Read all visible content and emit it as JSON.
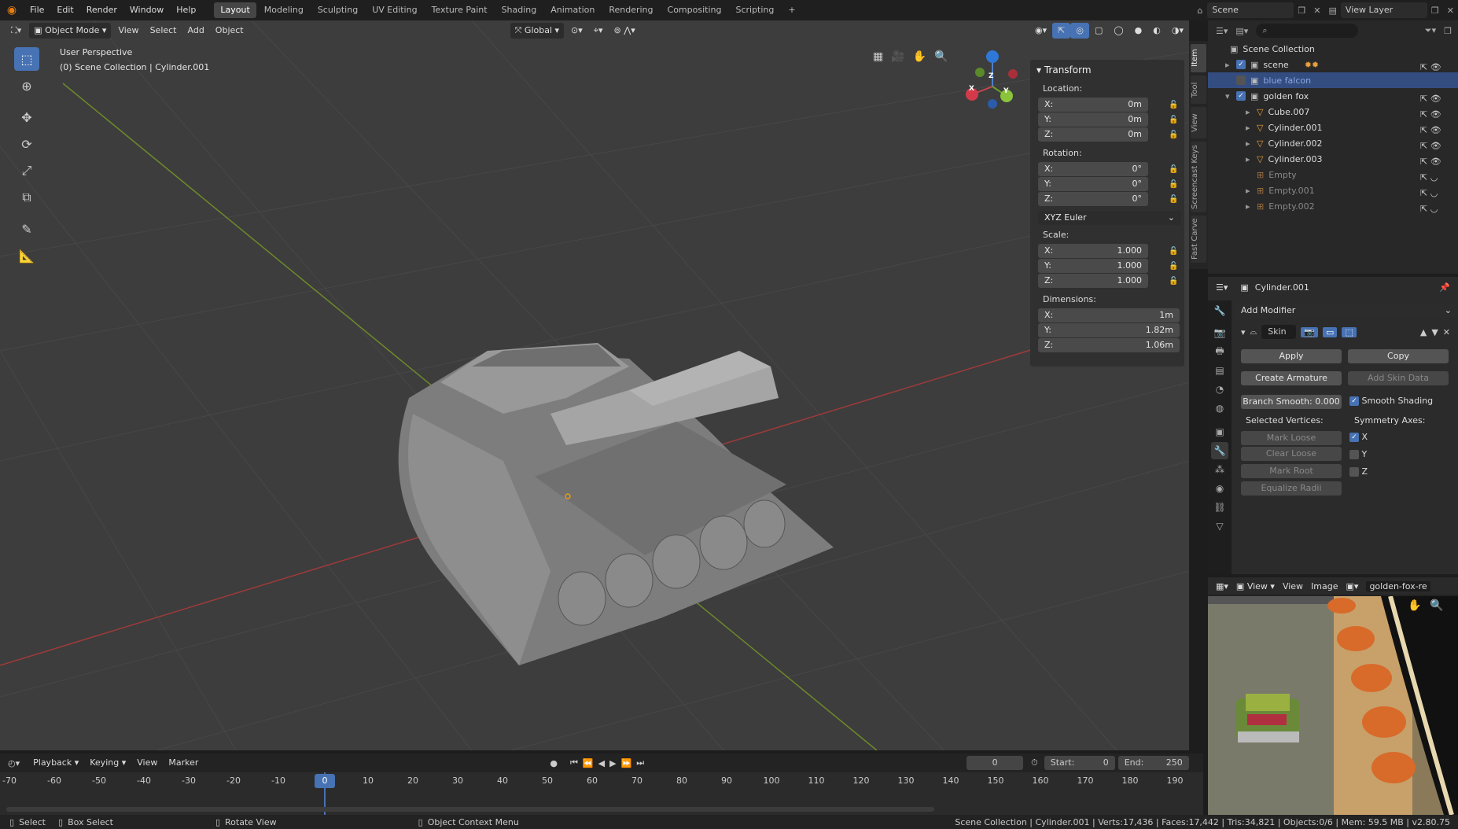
{
  "topbar": {
    "menus": [
      "File",
      "Edit",
      "Render",
      "Window",
      "Help"
    ],
    "workspaces": [
      "Layout",
      "Modeling",
      "Sculpting",
      "UV Editing",
      "Texture Paint",
      "Shading",
      "Animation",
      "Rendering",
      "Compositing",
      "Scripting"
    ],
    "active_workspace": "Layout",
    "add_tab": "+",
    "scene": "Scene",
    "view_layer": "View Layer"
  },
  "viewport": {
    "mode": "Object Mode",
    "menus": [
      "View",
      "Select",
      "Add",
      "Object"
    ],
    "orientation": "Global",
    "perspective_label": "User Perspective",
    "collection_label": "(0) Scene Collection | Cylinder.001",
    "gizmo": {
      "x": "X",
      "y": "Y",
      "z": "Z"
    }
  },
  "transform": {
    "title": "Transform",
    "location_label": "Location:",
    "location": [
      {
        "axis": "X:",
        "value": "0m"
      },
      {
        "axis": "Y:",
        "value": "0m"
      },
      {
        "axis": "Z:",
        "value": "0m"
      }
    ],
    "rotation_label": "Rotation:",
    "rotation": [
      {
        "axis": "X:",
        "value": "0°"
      },
      {
        "axis": "Y:",
        "value": "0°"
      },
      {
        "axis": "Z:",
        "value": "0°"
      }
    ],
    "rotation_mode": "XYZ Euler",
    "scale_label": "Scale:",
    "scale": [
      {
        "axis": "X:",
        "value": "1.000"
      },
      {
        "axis": "Y:",
        "value": "1.000"
      },
      {
        "axis": "Z:",
        "value": "1.000"
      }
    ],
    "dimensions_label": "Dimensions:",
    "dimensions": [
      {
        "axis": "X:",
        "value": "1m"
      },
      {
        "axis": "Y:",
        "value": "1.82m"
      },
      {
        "axis": "Z:",
        "value": "1.06m"
      }
    ]
  },
  "side_tabs": [
    "Item",
    "Tool",
    "View",
    "Screencast Keys",
    "Fast Carve"
  ],
  "outliner": {
    "root": "Scene Collection",
    "rows": [
      {
        "name": "scene",
        "indent": 1
      },
      {
        "name": "blue falcon",
        "indent": 1
      },
      {
        "name": "golden fox",
        "indent": 1
      },
      {
        "name": "Cube.007",
        "indent": 2
      },
      {
        "name": "Cylinder.001",
        "indent": 2
      },
      {
        "name": "Cylinder.002",
        "indent": 2
      },
      {
        "name": "Cylinder.003",
        "indent": 2
      },
      {
        "name": "Empty",
        "indent": 2
      },
      {
        "name": "Empty.001",
        "indent": 2
      },
      {
        "name": "Empty.002",
        "indent": 2
      }
    ]
  },
  "properties": {
    "object_name": "Cylinder.001",
    "add_modifier": "Add Modifier",
    "modifier_name": "Skin",
    "apply": "Apply",
    "copy": "Copy",
    "create_armature": "Create Armature",
    "add_skin_data": "Add Skin Data",
    "branch_smooth": "Branch Smooth: 0.000",
    "smooth_shading": "Smooth Shading",
    "selected_vertices": "Selected Vertices:",
    "symmetry_axes": "Symmetry Axes:",
    "mark_loose": "Mark Loose",
    "clear_loose": "Clear Loose",
    "mark_root": "Mark Root",
    "equalize_radii": "Equalize Radii",
    "axes": [
      {
        "label": "X",
        "checked": true
      },
      {
        "label": "Y",
        "checked": false
      },
      {
        "label": "Z",
        "checked": false
      }
    ]
  },
  "image_editor": {
    "menus": [
      "View",
      "View",
      "Image"
    ],
    "image_name": "golden-fox-re"
  },
  "timeline": {
    "menus": [
      "Playback",
      "Keying",
      "View",
      "Marker"
    ],
    "current_frame": "0",
    "start_label": "Start:",
    "start": "0",
    "end_label": "End:",
    "end": "250",
    "ticks": [
      "-70",
      "-60",
      "-50",
      "-40",
      "-30",
      "-20",
      "-10",
      "0",
      "10",
      "20",
      "30",
      "40",
      "50",
      "60",
      "70",
      "80",
      "90",
      "100",
      "110",
      "120",
      "130",
      "140",
      "150",
      "160",
      "170",
      "180",
      "190"
    ]
  },
  "statusbar": {
    "select": "Select",
    "box_select": "Box Select",
    "rotate_view": "Rotate View",
    "context_menu": "Object Context Menu",
    "stats": "Scene Collection | Cylinder.001 | Verts:17,436 | Faces:17,442 | Tris:34,821 | Objects:0/6 | Mem: 59.5 MB | v2.80.75"
  }
}
